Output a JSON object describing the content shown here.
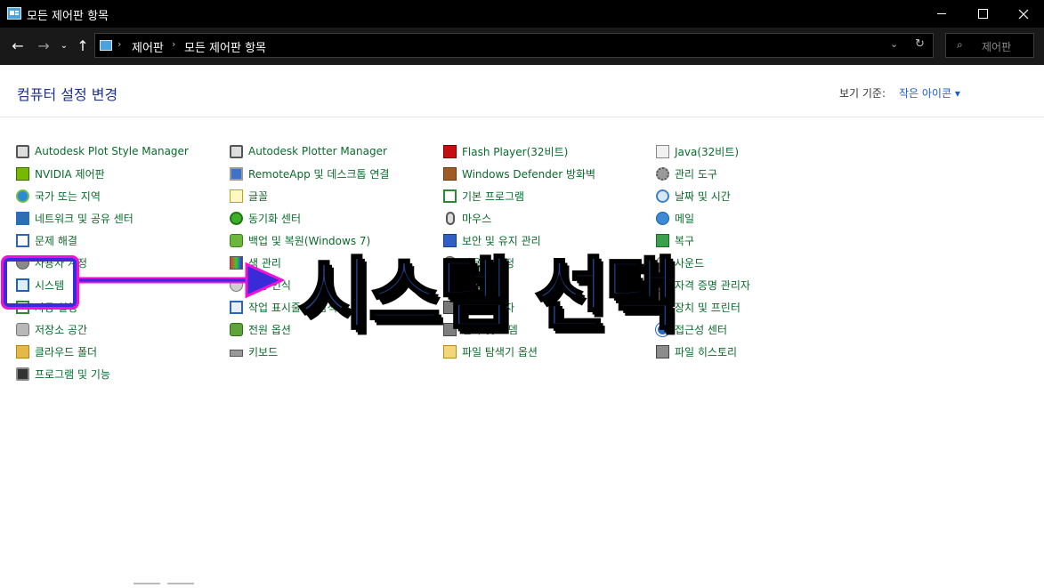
{
  "window": {
    "title": "모든 제어판 항목",
    "icon": "control-panel-icon"
  },
  "nav": {
    "back": "←",
    "forward": "→",
    "recent": "⌄",
    "up": "↑"
  },
  "address": {
    "crumbs": [
      "제어판",
      "모든 제어판 항목"
    ],
    "separator": "›",
    "dropdown": "⌄",
    "refresh": "↻"
  },
  "search": {
    "placeholder": "제어판",
    "icon": "⌕"
  },
  "header": {
    "title": "컴퓨터 설정 변경",
    "view_by_label": "보기 기준:",
    "view_by_value": "작은 아이콘 ▾"
  },
  "columns": [
    [
      {
        "label": "Autodesk Plot Style Manager",
        "icon": "plot"
      },
      {
        "label": "NVIDIA 제어판",
        "icon": "nvidia"
      },
      {
        "label": "국가 또는 지역",
        "icon": "globe"
      },
      {
        "label": "네트워크 및 공유 센터",
        "icon": "network"
      },
      {
        "label": "문제 해결",
        "icon": "trouble"
      },
      {
        "label": "사용자 계정",
        "icon": "user"
      },
      {
        "label": "시스템",
        "icon": "monitor"
      },
      {
        "label": "자동 실행",
        "icon": "default"
      },
      {
        "label": "저장소 공간",
        "icon": "storage"
      },
      {
        "label": "클라우드 폴더",
        "icon": "folder"
      },
      {
        "label": "프로그램 및 기능",
        "icon": "program"
      }
    ],
    [
      {
        "label": "Autodesk Plotter Manager",
        "icon": "plot"
      },
      {
        "label": "RemoteApp 및 데스크톱 연결",
        "icon": "remote"
      },
      {
        "label": "글꼴",
        "icon": "font"
      },
      {
        "label": "동기화 센터",
        "icon": "sync"
      },
      {
        "label": "백업 및 복원(Windows 7)",
        "icon": "backup"
      },
      {
        "label": "색 관리",
        "icon": "color"
      },
      {
        "label": "음성 인식",
        "icon": "speech"
      },
      {
        "label": "작업 표시줄 및 탐색",
        "icon": "taskbar"
      },
      {
        "label": "전원 옵션",
        "icon": "power"
      },
      {
        "label": "키보드",
        "icon": "keyboard"
      }
    ],
    [
      {
        "label": "Flash Player(32비트)",
        "icon": "flash"
      },
      {
        "label": "Windows Defender 방화벽",
        "icon": "defender"
      },
      {
        "label": "기본 프로그램",
        "icon": "default"
      },
      {
        "label": "마우스",
        "icon": "mouse"
      },
      {
        "label": "보안 및 유지 관리",
        "icon": "flag"
      },
      {
        "label": "사용자 계정",
        "icon": "user"
      },
      {
        "label": "작업 폴더",
        "icon": "default"
      },
      {
        "label": "장치 관리자",
        "icon": "printer"
      },
      {
        "label": "전화 및 모뎀",
        "icon": "phone"
      },
      {
        "label": "파일 탐색기 옵션",
        "icon": "explorer"
      }
    ],
    [
      {
        "label": "Java(32비트)",
        "icon": "java"
      },
      {
        "label": "관리 도구",
        "icon": "admin"
      },
      {
        "label": "날짜 및 시간",
        "icon": "clock"
      },
      {
        "label": "메일",
        "icon": "mail"
      },
      {
        "label": "복구",
        "icon": "recovery"
      },
      {
        "label": "사운드",
        "icon": "speech"
      },
      {
        "label": "자격 증명 관리자",
        "icon": "cert"
      },
      {
        "label": "장치 및 프린터",
        "icon": "printer"
      },
      {
        "label": "접근성 센터",
        "icon": "access"
      },
      {
        "label": "파일 히스토리",
        "icon": "history"
      }
    ]
  ],
  "annotation": {
    "text": "시스템 선택",
    "highlight_color": "#3a2bd8",
    "glow_color": "#f20fd8",
    "text_color": "#1f3f82"
  }
}
